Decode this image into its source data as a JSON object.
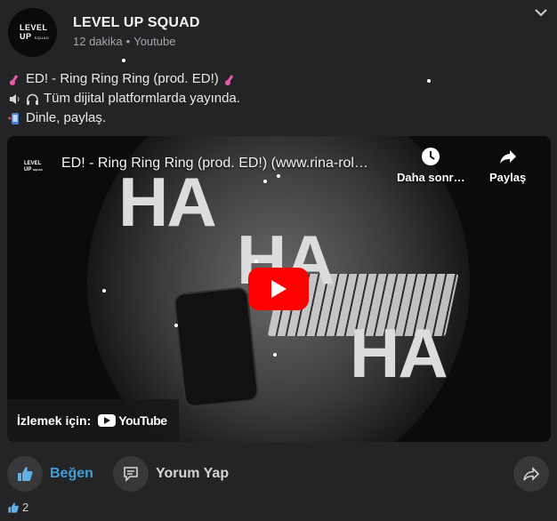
{
  "post": {
    "page_name": "LEVEL UP SQUAD",
    "avatar_text": {
      "line1": "LEVEL",
      "line2": "UP",
      "line3": "SQUAD"
    },
    "time": "12 dakika",
    "separator": "•",
    "source": "Youtube",
    "lines": [
      {
        "icon": "electric-guitar-icon",
        "text": "ED! - Ring Ring Ring (prod. ED!)",
        "trail_icon": "electric-guitar-icon"
      },
      {
        "icon": "speaker-icon",
        "icon2": "headphone-icon",
        "text": "Tüm dijital platformlarda yayında."
      },
      {
        "icon": "mobile-icon",
        "text": "Dinle, paylaş."
      }
    ]
  },
  "video": {
    "channel_logo": {
      "line1": "LEVEL",
      "line2": "UP",
      "line3": "SQUAD"
    },
    "title": "ED! - Ring Ring Ring (prod. ED!) (www.rina-rol…",
    "watch_later_label": "Daha sonr…",
    "share_label": "Paylaş",
    "watch_on_label": "İzlemek için:",
    "youtube_label": "YouTube",
    "overlay_words": [
      "HA",
      "HA",
      "HA"
    ],
    "colors": {
      "play_button": "#ff0000"
    }
  },
  "actions": {
    "like_label": "Beğen",
    "comment_label": "Yorum Yap",
    "like_color": "#3f9fd6"
  },
  "reactions": {
    "icon": "thumbs-up-icon",
    "count": "2"
  }
}
